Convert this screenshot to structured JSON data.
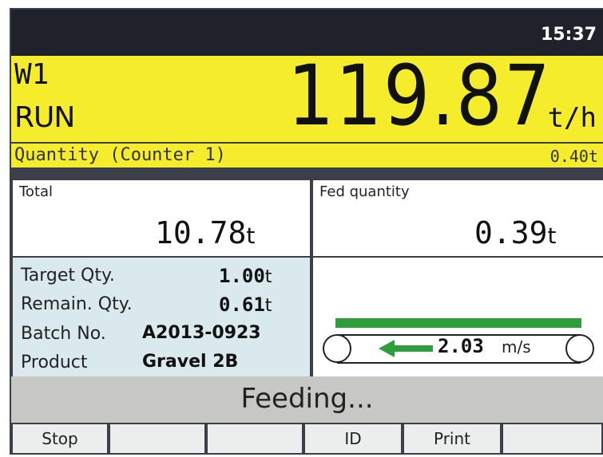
{
  "header": {
    "time": "15:37"
  },
  "main": {
    "weigher_id": "W1",
    "state": "RUN",
    "flow_rate": "119.87",
    "flow_unit": "t/h",
    "counter_label": "Quantity (Counter 1)",
    "counter_value": "0.40t"
  },
  "totals": {
    "total_label": "Total",
    "total_value": "10.78",
    "total_unit": "t",
    "fed_label": "Fed quantity",
    "fed_value": "0.39",
    "fed_unit": "t"
  },
  "batch": {
    "target_label": "Target Qty.",
    "target_value": "1.00",
    "target_unit": "t",
    "remain_label": "Remain. Qty.",
    "remain_value": "0.61",
    "remain_unit": "t",
    "batch_label": "Batch No.",
    "batch_value": "A2013-0923",
    "product_label": "Product",
    "product_value": "Gravel 2B"
  },
  "belt": {
    "speed_value": "2.03",
    "speed_unit": "m/s",
    "belt_color": "#2e9e3a",
    "arrow_icon": "arrow-left-icon"
  },
  "status": {
    "text": "Feeding..."
  },
  "softkeys": [
    "Stop",
    "",
    "",
    "ID",
    "Print",
    ""
  ]
}
